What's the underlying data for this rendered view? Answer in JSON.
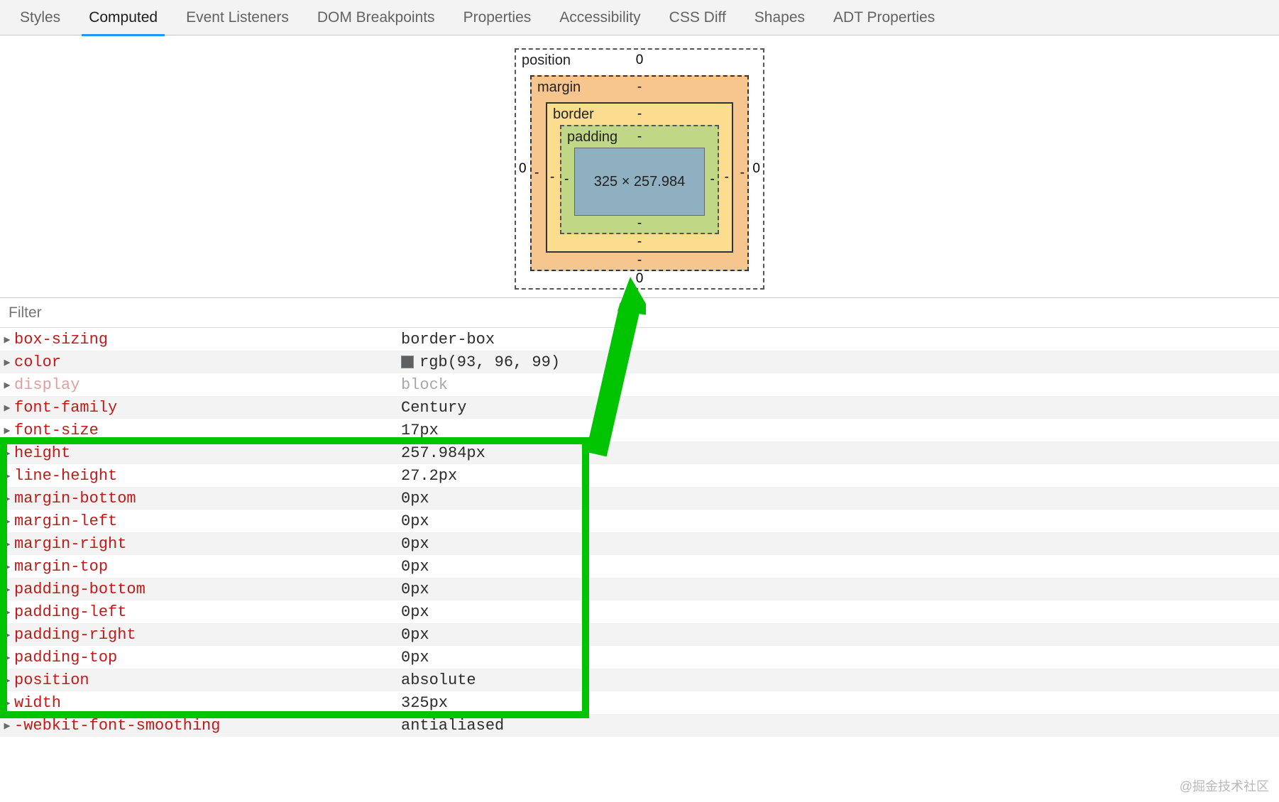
{
  "tabs": [
    "Styles",
    "Computed",
    "Event Listeners",
    "DOM Breakpoints",
    "Properties",
    "Accessibility",
    "CSS Diff",
    "Shapes",
    "ADT Properties"
  ],
  "activeTab": 1,
  "boxModel": {
    "position": {
      "label": "position",
      "top": "0",
      "right": "0",
      "bottom": "0",
      "left": "0"
    },
    "margin": {
      "label": "margin",
      "top": "-",
      "right": "-",
      "bottom": "-",
      "left": "-"
    },
    "border": {
      "label": "border",
      "top": "-",
      "right": "-",
      "bottom": "-",
      "left": "-"
    },
    "padding": {
      "label": "padding",
      "top": "-",
      "right": "-",
      "bottom": "-",
      "left": "-"
    },
    "content": "325 × 257.984"
  },
  "filterPlaceholder": "Filter",
  "props": [
    {
      "name": "box-sizing",
      "value": "border-box"
    },
    {
      "name": "color",
      "value": "rgb(93, 96, 99)",
      "swatch": "#5d6063"
    },
    {
      "name": "display",
      "value": "block",
      "dim": true
    },
    {
      "name": "font-family",
      "value": "Century"
    },
    {
      "name": "font-size",
      "value": "17px"
    },
    {
      "name": "height",
      "value": "257.984px"
    },
    {
      "name": "line-height",
      "value": "27.2px"
    },
    {
      "name": "margin-bottom",
      "value": "0px"
    },
    {
      "name": "margin-left",
      "value": "0px"
    },
    {
      "name": "margin-right",
      "value": "0px"
    },
    {
      "name": "margin-top",
      "value": "0px"
    },
    {
      "name": "padding-bottom",
      "value": "0px"
    },
    {
      "name": "padding-left",
      "value": "0px"
    },
    {
      "name": "padding-right",
      "value": "0px"
    },
    {
      "name": "padding-top",
      "value": "0px"
    },
    {
      "name": "position",
      "value": "absolute"
    },
    {
      "name": "width",
      "value": "325px"
    },
    {
      "name": "-webkit-font-smoothing",
      "value": "antialiased"
    }
  ],
  "highlight": {
    "fromIndex": 5,
    "toIndex": 16,
    "_comment": "green box around height..width rows"
  },
  "watermark": "@掘金技术社区"
}
